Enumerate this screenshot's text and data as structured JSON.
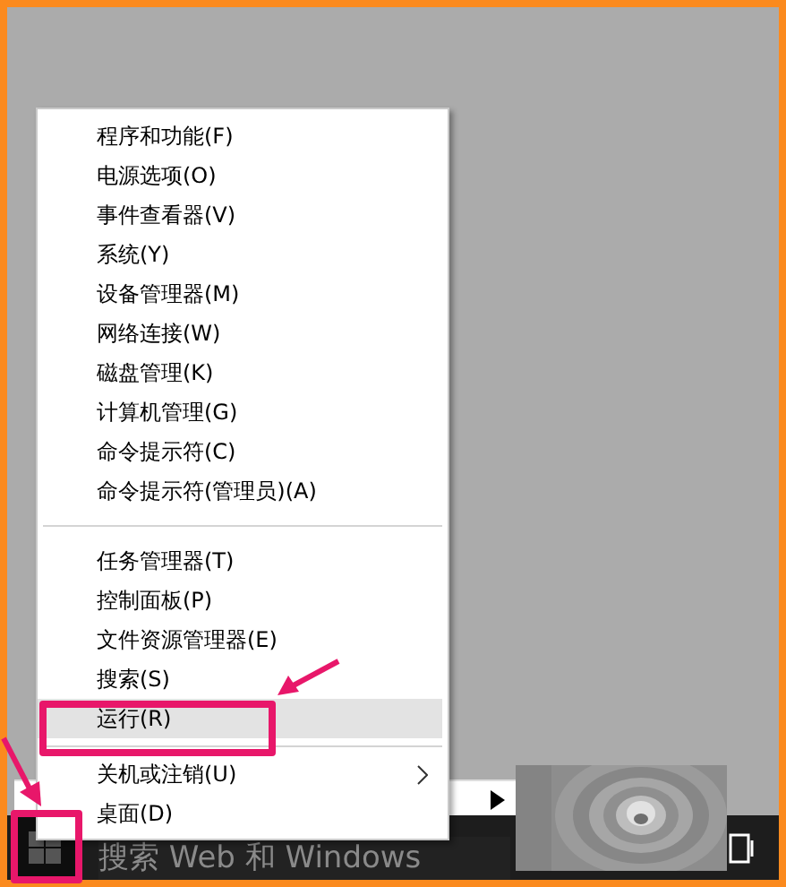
{
  "context_menu": {
    "groups": [
      [
        {
          "label": "程序和功能(F)",
          "selected": false,
          "submenu": false
        },
        {
          "label": "电源选项(O)",
          "selected": false,
          "submenu": false
        },
        {
          "label": "事件查看器(V)",
          "selected": false,
          "submenu": false
        },
        {
          "label": "系统(Y)",
          "selected": false,
          "submenu": false
        },
        {
          "label": "设备管理器(M)",
          "selected": false,
          "submenu": false
        },
        {
          "label": "网络连接(W)",
          "selected": false,
          "submenu": false
        },
        {
          "label": "磁盘管理(K)",
          "selected": false,
          "submenu": false
        },
        {
          "label": "计算机管理(G)",
          "selected": false,
          "submenu": false
        },
        {
          "label": "命令提示符(C)",
          "selected": false,
          "submenu": false
        },
        {
          "label": "命令提示符(管理员)(A)",
          "selected": false,
          "submenu": false
        }
      ],
      [
        {
          "label": "任务管理器(T)",
          "selected": false,
          "submenu": false
        },
        {
          "label": "控制面板(P)",
          "selected": false,
          "submenu": false
        },
        {
          "label": "文件资源管理器(E)",
          "selected": false,
          "submenu": false
        },
        {
          "label": "搜索(S)",
          "selected": false,
          "submenu": false
        },
        {
          "label": "运行(R)",
          "selected": true,
          "submenu": false
        }
      ],
      [
        {
          "label": "关机或注销(U)",
          "selected": false,
          "submenu": true
        },
        {
          "label": "桌面(D)",
          "selected": false,
          "submenu": false
        }
      ]
    ]
  },
  "taskbar": {
    "search": {
      "placeholder": "搜索 Web 和 Windows"
    }
  }
}
